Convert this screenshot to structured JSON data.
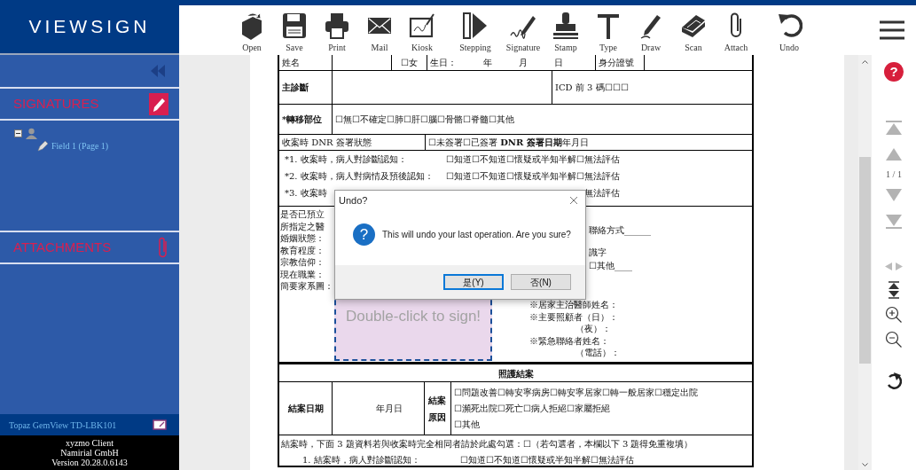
{
  "sidebar": {
    "logo": "VIEWSIGN",
    "signatures": {
      "title": "SIGNATURES",
      "tree": [
        {
          "expanded": true,
          "children": [
            {
              "label": "Field 1 (Page 1)"
            }
          ]
        }
      ]
    },
    "attachments": {
      "title": "ATTACHMENTS"
    },
    "device": "Topaz GemView TD-LBK101",
    "about": [
      "xyzmo Client",
      "Namirial GmbH",
      "Version 20.28.0.6143"
    ]
  },
  "toolbar": {
    "buttons": [
      {
        "label": "Open"
      },
      {
        "label": "Save"
      },
      {
        "label": "Print"
      },
      {
        "label": "Mail"
      },
      {
        "label": "Kiosk"
      },
      {
        "label": "Stepping"
      },
      {
        "label": "Signature"
      },
      {
        "label": "Stamp"
      },
      {
        "label": "Type"
      },
      {
        "label": "Draw"
      },
      {
        "label": "Scan"
      },
      {
        "label": "Attach"
      },
      {
        "label": "Undo"
      }
    ]
  },
  "document": {
    "top_row": [
      "姓名",
      "☐女",
      "生日：　　　年　　　月　　　日",
      "身分證號"
    ],
    "diagnosis": {
      "label": "主診斷",
      "icd": "ICD 前 3 碼☐☐☐"
    },
    "metastasis": {
      "label": "*轉移部位",
      "options": "☐無☐不確定☐肺☐肝☐腦☐骨骼☐脊髓☐其他"
    },
    "dnr": {
      "label": "收案時 DNR 簽署狀態",
      "value": "☐未簽署☐已簽署 **DNR 簽署日期**年月日"
    },
    "questions": [
      {
        "question": "*1. 收案時，病人對診斷認知：",
        "options": "☐知道☐不知道☐懷疑或半知半解☐無法評估"
      },
      {
        "question": "*2. 收案時，病人對病情及預後認知：",
        "options": "☐知道☐不知道☐懷疑或半知半解☐無法評估"
      },
      {
        "question": "*3. 收案時",
        "options": "無法評估"
      }
    ],
    "profile": {
      "left": [
        "是否已預立",
        "所指定之醫",
        "婚姻狀態：",
        "教育程度：",
        "宗教信仰：",
        "現在職業：",
        "簡要家系圖："
      ],
      "right_notes": [
        "聯絡方式______",
        "識字",
        "☐其他____"
      ],
      "signature_field": "Double-click to sign!",
      "contacts": [
        {
          "kind": "label",
          "text": "※居家主治醫師姓名："
        },
        {
          "kind": "label",
          "text": "※主要照顧者（日）："
        },
        {
          "kind": "continuation",
          "text": "（夜）："
        },
        {
          "kind": "label",
          "text": "※緊急聯絡者姓名："
        },
        {
          "kind": "continuation",
          "text": "（電話）："
        }
      ]
    },
    "closure": {
      "title": "照護結案",
      "date_label": "結案日期",
      "date_value": "年月日",
      "reason_label": "結案原因",
      "reasons": [
        "☐問題改善☐轉安寧病房☐轉安寧居家☐轉一般居家☐穩定出院",
        "☐瀕死出院☐死亡☐病人拒絕☐家屬拒絕",
        "☐其他"
      ]
    },
    "closure_note": "結案時，下面 3 題資料若與收案時完全相同者請於此處勾選：☐（若勾選者，本欄以下 3 題得免重複填）",
    "closure_questions": [
      {
        "question": "1. 結案時，病人對診斷認知：",
        "options": "☐知道☐不知道☐懷疑或半知半解☐無法評估"
      }
    ]
  },
  "navigator": {
    "help": "?",
    "page": "1 / 1"
  },
  "dialog": {
    "title": "Undo?",
    "icon": "?",
    "message": "This will undo your last operation. Are you sure?",
    "buttons": [
      {
        "label": "是(Y)",
        "default": true
      },
      {
        "label": "否(N)",
        "default": false
      }
    ]
  }
}
